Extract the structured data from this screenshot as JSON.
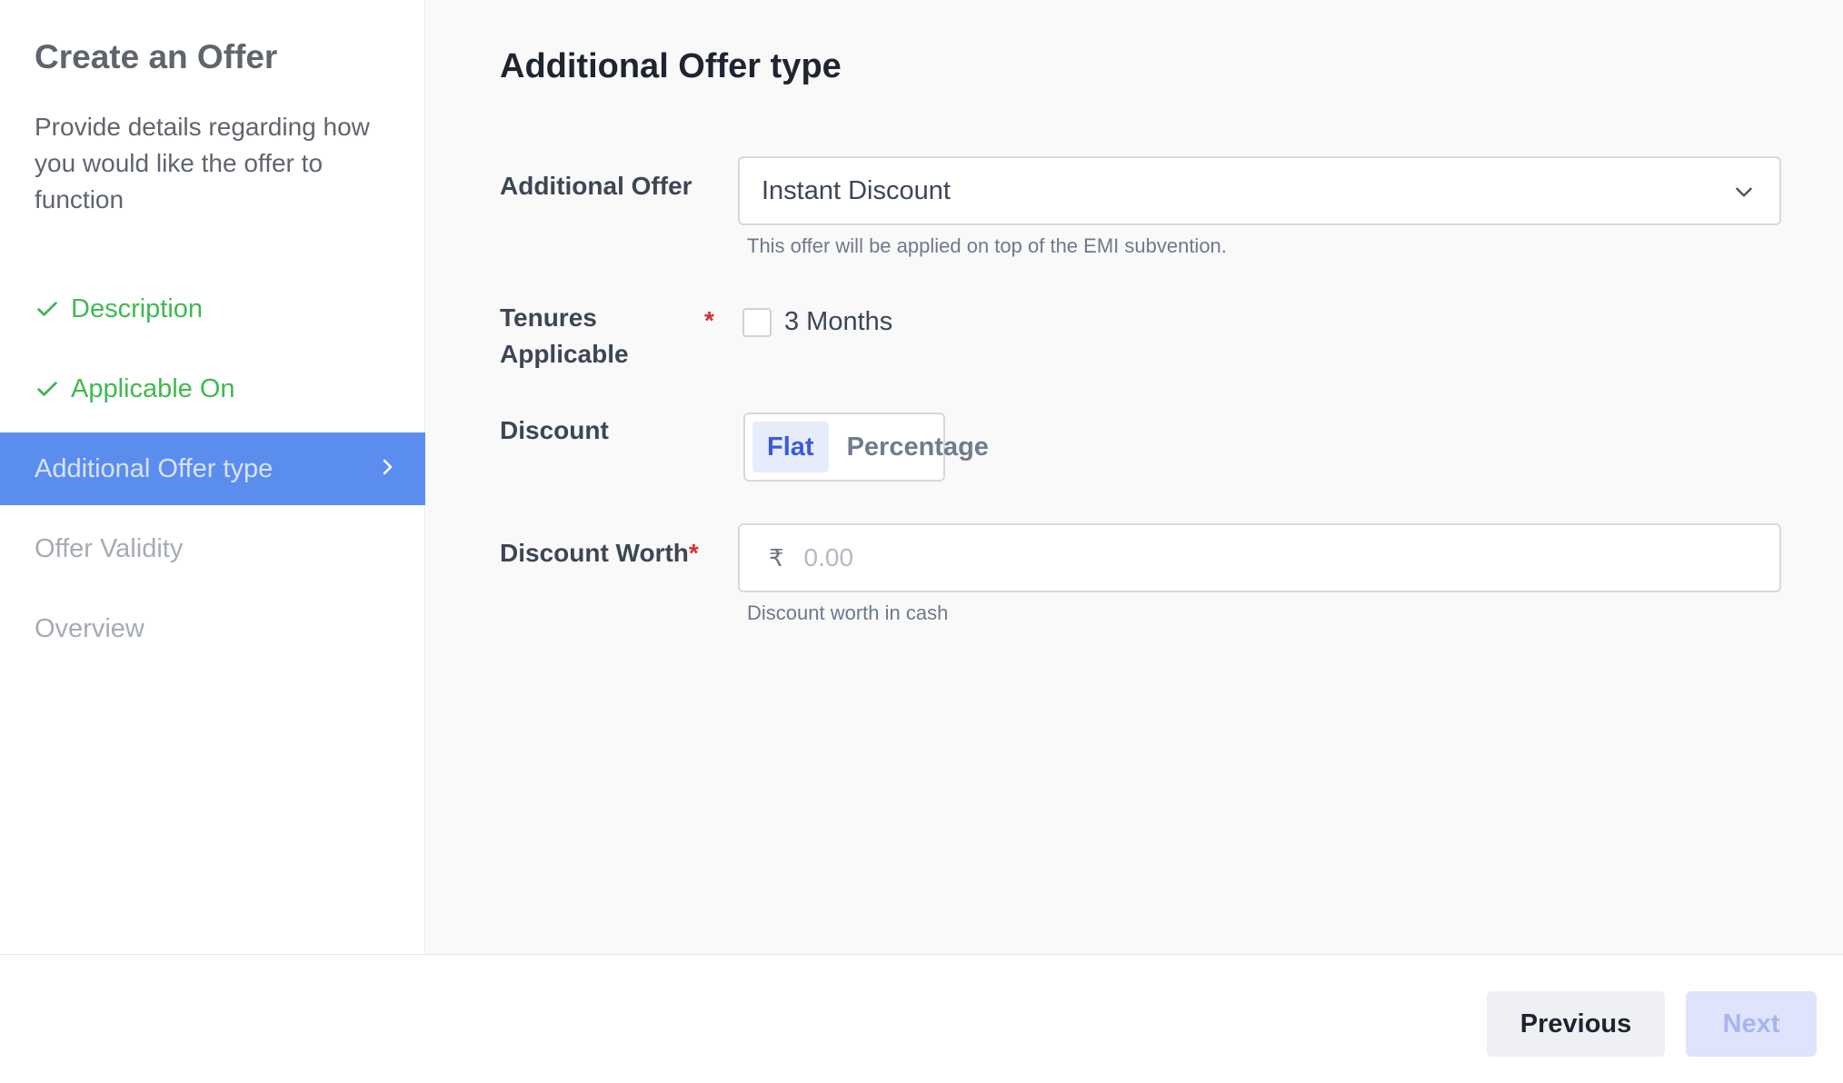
{
  "sidebar": {
    "title": "Create an Offer",
    "description": "Provide details regarding how you would like the offer to function",
    "steps": [
      {
        "label": "Description",
        "status": "done",
        "icon": "check-icon"
      },
      {
        "label": "Applicable On",
        "status": "done",
        "icon": "check-icon"
      },
      {
        "label": "Additional Offer type",
        "status": "active",
        "icon": "chevron-right-icon"
      },
      {
        "label": "Offer Validity",
        "status": "pending"
      },
      {
        "label": "Overview",
        "status": "pending"
      }
    ]
  },
  "main": {
    "title": "Additional Offer type",
    "additional_offer": {
      "label": "Additional Offer",
      "value": "Instant Discount",
      "help": "This offer will be applied on top of the EMI subvention."
    },
    "tenures": {
      "label_line1": "Tenures",
      "label_line2": "Applicable",
      "required_mark": "*",
      "options": [
        {
          "label": "3 Months",
          "checked": false
        }
      ]
    },
    "discount": {
      "label": "Discount",
      "options": [
        "Flat",
        "Percentage"
      ],
      "selected": "Flat"
    },
    "discount_worth": {
      "label": "Discount Worth",
      "required_mark": "*",
      "currency_symbol": "₹",
      "placeholder": "0.00",
      "help": "Discount worth in cash"
    }
  },
  "footer": {
    "previous_label": "Previous",
    "next_label": "Next"
  },
  "colors": {
    "done": "#3fb950",
    "active_bg": "#5b8def",
    "accent": "#3b5bdb",
    "required": "#d53030"
  }
}
